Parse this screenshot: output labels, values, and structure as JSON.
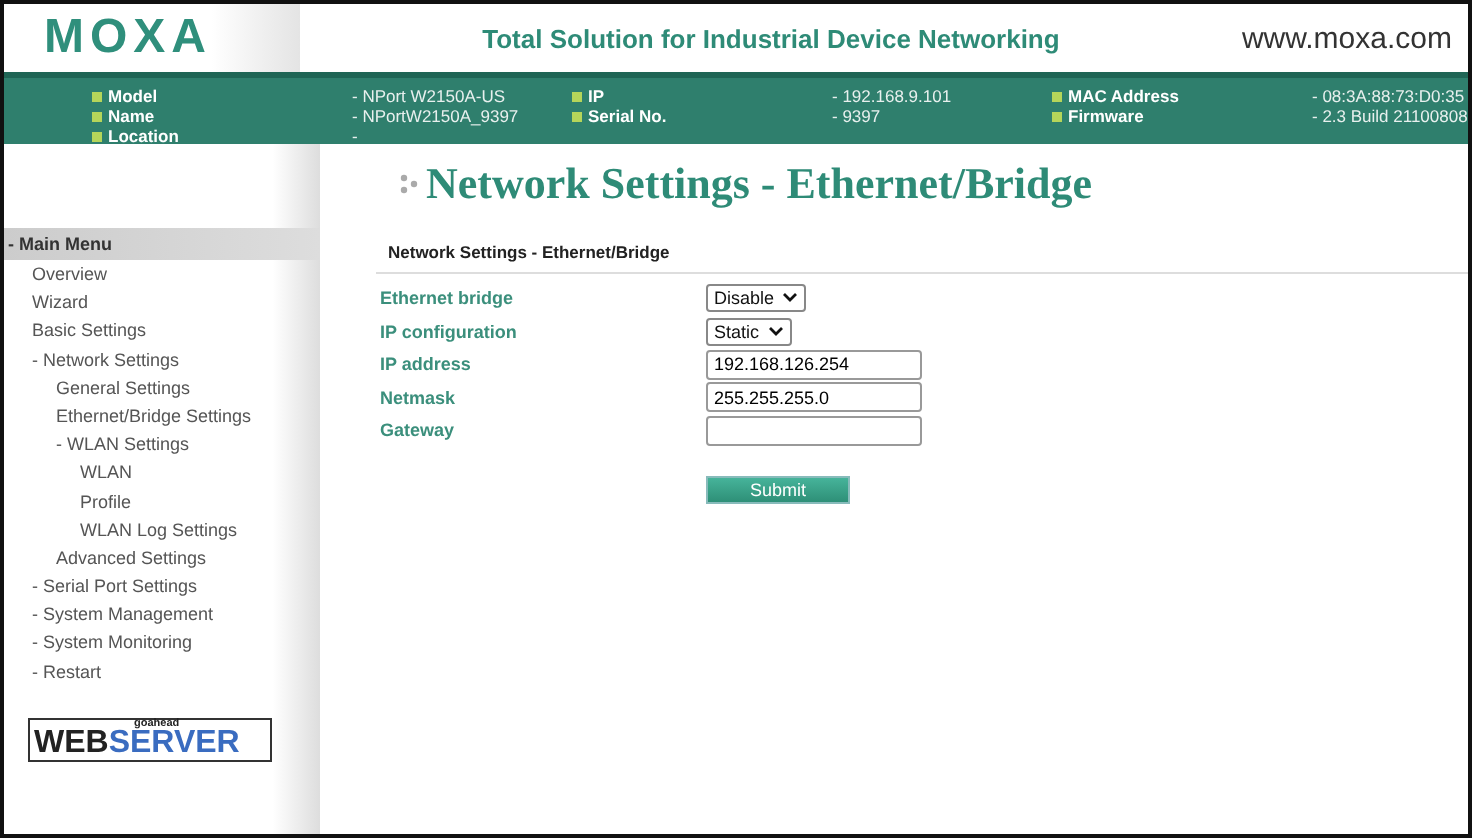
{
  "header": {
    "logo": "MOXA",
    "tagline": "Total Solution for Industrial Device Networking",
    "website": "www.moxa.com"
  },
  "info": [
    {
      "label": "Model",
      "value": "- NPort W2150A-US"
    },
    {
      "label": "IP",
      "value": "- 192.168.9.101"
    },
    {
      "label": "MAC Address",
      "value": "- 08:3A:88:73:D0:35"
    },
    {
      "label": "Name",
      "value": "- NPortW2150A_9397"
    },
    {
      "label": "Serial No.",
      "value": "- 9397"
    },
    {
      "label": "Firmware",
      "value": "- 2.3 Build 21100808"
    },
    {
      "label": "Location",
      "value": "-"
    }
  ],
  "sidebar": {
    "title": "- Main Menu",
    "items": [
      {
        "label": "Overview"
      },
      {
        "label": "Wizard"
      },
      {
        "label": "Basic Settings"
      },
      {
        "label": "- Network Settings",
        "children": [
          {
            "label": "General Settings"
          },
          {
            "label": "Ethernet/Bridge Settings"
          },
          {
            "label": "- WLAN Settings",
            "children": [
              {
                "label": "WLAN"
              },
              {
                "label": "Profile"
              },
              {
                "label": "WLAN Log Settings"
              }
            ]
          },
          {
            "label": "Advanced Settings"
          }
        ]
      },
      {
        "label": "- Serial Port Settings"
      },
      {
        "label": "- System Management"
      },
      {
        "label": "- System Monitoring"
      },
      {
        "label": "- Restart"
      }
    ],
    "badge": {
      "small": "goahead",
      "left": "WEB",
      "right": "SERVER"
    }
  },
  "page": {
    "title": "Network Settings - Ethernet/Bridge",
    "section": "Network Settings - Ethernet/Bridge",
    "fields": [
      {
        "label": "Ethernet bridge",
        "kind": "select",
        "value": "Disable"
      },
      {
        "label": "IP configuration",
        "kind": "select",
        "value": "Static"
      },
      {
        "label": "IP address",
        "kind": "input",
        "value": "192.168.126.254"
      },
      {
        "label": "Netmask",
        "kind": "input",
        "value": "255.255.255.0"
      },
      {
        "label": "Gateway",
        "kind": "input"
      }
    ],
    "submit": "Submit"
  }
}
